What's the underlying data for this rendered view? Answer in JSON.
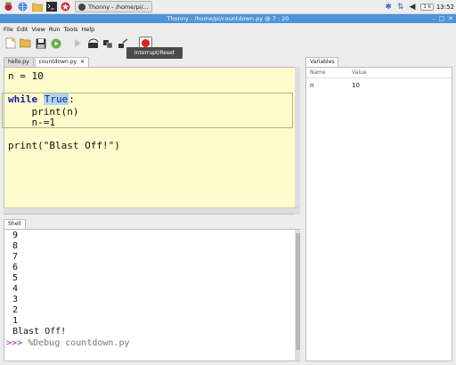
{
  "panel": {
    "task_title": "Thonny - /home/pi/...",
    "keyboard": "1 k",
    "clock": "13:52"
  },
  "window": {
    "title": "Thonny - /home/pi/countdown.py @ 7 : 20"
  },
  "menu": [
    "File",
    "Edit",
    "View",
    "Run",
    "Tools",
    "Help"
  ],
  "tooltip": "Interrupt/Reset",
  "editor": {
    "tabs": [
      {
        "label": "hello.py",
        "active": false
      },
      {
        "label": "countdown.py",
        "active": true
      }
    ],
    "lines": [
      "n = 10",
      "",
      "while True:",
      "    print(n)",
      "    n-=1",
      "",
      "print(\"Blast Off!\")"
    ],
    "code": {
      "l1": "n = 10",
      "l3_kw": "while",
      "l3_true": "True",
      "l3_rest": ":",
      "l4": "    print(n)",
      "l5": "    n-=1",
      "l7": "print(\"Blast Off!\")"
    }
  },
  "shell": {
    "tab": "Shell",
    "output": [
      "9",
      "8",
      "7",
      "6",
      "5",
      "4",
      "3",
      "2",
      "1",
      "Blast Off!"
    ],
    "prompt": ">>>",
    "command": "%Debug countdown.py"
  },
  "variables": {
    "tab": "Variables",
    "col_name": "Name",
    "col_value": "Value",
    "rows": [
      {
        "name": "n",
        "value": "10"
      }
    ]
  }
}
